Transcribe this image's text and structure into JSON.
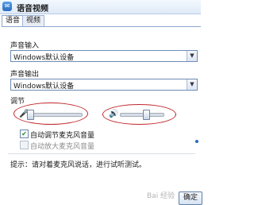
{
  "window": {
    "title": "语音视频",
    "icon": "chat-app-icon"
  },
  "tabs": [
    {
      "label": "语音",
      "active": true
    },
    {
      "label": "视频",
      "active": false
    }
  ],
  "input": {
    "label": "声音输入",
    "value": "Windows默认设备"
  },
  "output": {
    "label": "声音输出",
    "value": "Windows默认设备"
  },
  "adjust": {
    "label": "调节",
    "input_volume_level": 0.0,
    "output_volume_level": 0.62
  },
  "checkboxes": [
    {
      "label": "自动调节麦克风音量",
      "checked": true,
      "enabled": true
    },
    {
      "label": "自动放大麦克风音量",
      "checked": false,
      "enabled": false
    }
  ],
  "hint": "提示：请对着麦克风说话，进行试听测试。",
  "ok_button": "确定",
  "watermark": "Bai 经验",
  "colors": {
    "highlight_ellipse": "#c0262b",
    "accent": "#2b6cbf"
  }
}
